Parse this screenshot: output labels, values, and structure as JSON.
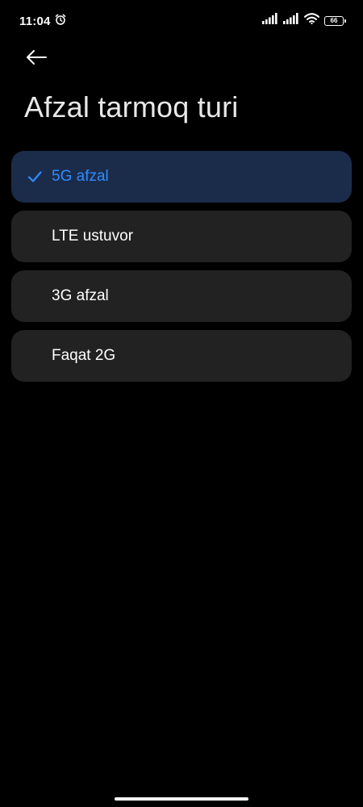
{
  "status_bar": {
    "time": "11:04",
    "battery_level": "66",
    "icons": [
      "alarm-icon",
      "signal-icon",
      "signal-icon",
      "wifi-icon",
      "battery-icon"
    ]
  },
  "header": {
    "back_icon": "arrow-left-icon",
    "title": "Afzal tarmoq turi"
  },
  "options": [
    {
      "label": "5G afzal",
      "selected": true
    },
    {
      "label": "LTE ustuvor",
      "selected": false
    },
    {
      "label": "3G afzal",
      "selected": false
    },
    {
      "label": "Faqat 2G",
      "selected": false
    }
  ],
  "colors": {
    "background": "#000000",
    "option_background": "#222222",
    "selected_background": "#1b2c4a",
    "accent": "#2f8cff"
  }
}
